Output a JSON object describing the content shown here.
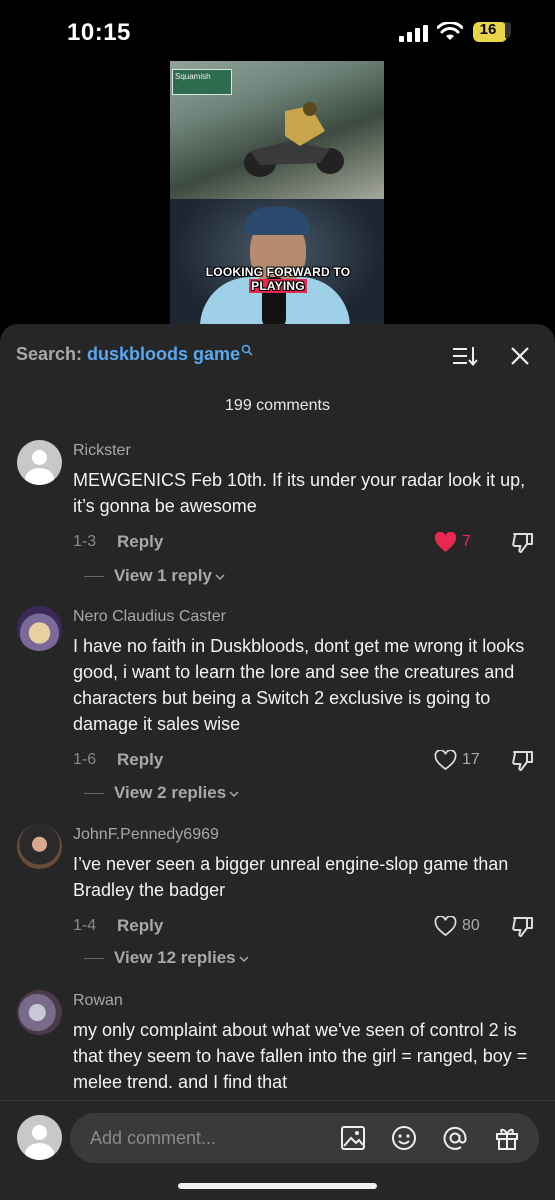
{
  "status_bar": {
    "time": "10:15",
    "battery_level": "16",
    "battery_color": "#e8d54a"
  },
  "video": {
    "sign_text": "Squamish",
    "caption_part1": "LOOKING FORWARD TO ",
    "caption_part2": "PLAYING"
  },
  "header": {
    "search_label": "Search: ",
    "search_term": "duskbloods game",
    "search_term_color": "#5aa8f0",
    "comment_count": "199 comments"
  },
  "comments": [
    {
      "username": "Rickster",
      "text": "MEWGENICS Feb 10th. If its under your radar look it up, it’s gonna be awesome",
      "date": "1-3",
      "reply_label": "Reply",
      "likes": "7",
      "liked": true,
      "view_replies": "View 1 reply"
    },
    {
      "username": "Nero Claudius Caster",
      "text": "I have no faith in Duskbloods, dont get me wrong it looks good, i want to learn the lore and see the creatures and characters but being a Switch 2 exclusive is going to damage it sales wise",
      "date": "1-6",
      "reply_label": "Reply",
      "likes": "17",
      "liked": false,
      "view_replies": "View 2 replies"
    },
    {
      "username": "JohnF.Pennedy6969",
      "text": "I’ve never seen a bigger unreal engine-slop game than Bradley the badger",
      "date": "1-4",
      "reply_label": "Reply",
      "likes": "80",
      "liked": false,
      "view_replies": "View 12 replies"
    },
    {
      "username": "Rowan",
      "text": "my only complaint about what we've seen of control 2 is that they seem to have fallen into the girl = ranged, boy = melee trend. and I find that"
    }
  ],
  "composer": {
    "placeholder": "Add comment..."
  },
  "colors": {
    "like_red": "#e8284e",
    "sheet_bg": "#262626"
  }
}
